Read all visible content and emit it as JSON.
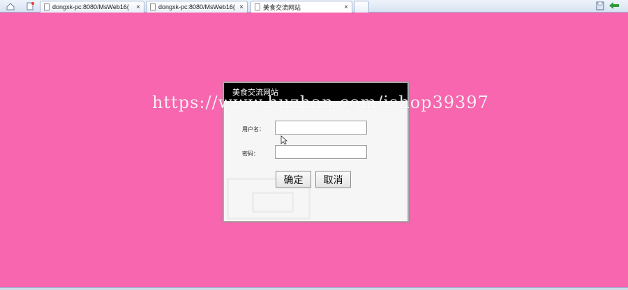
{
  "browser": {
    "tabs": [
      {
        "label": "dongxk-pc:8080/MsWeb16(",
        "close": "×"
      },
      {
        "label": "dongxk-pc:8080/MsWeb16(",
        "close": "×"
      },
      {
        "label": "美食交流网站",
        "close": "×"
      }
    ],
    "icons": {
      "home": "home-icon",
      "page": "page-icon",
      "save": "save-icon",
      "back": "back-icon"
    }
  },
  "watermark": "https://www.huzhan.com/ishop39397",
  "dialog": {
    "title": "美食交流网站",
    "username_label": "用户名：",
    "username_value": "",
    "password_label": "密码：",
    "password_value": "",
    "ok_label": "确定",
    "cancel_label": "取消"
  },
  "colors": {
    "background": "#f766ae",
    "titlebar": "#000000",
    "dialog": "#f6f6f6"
  }
}
